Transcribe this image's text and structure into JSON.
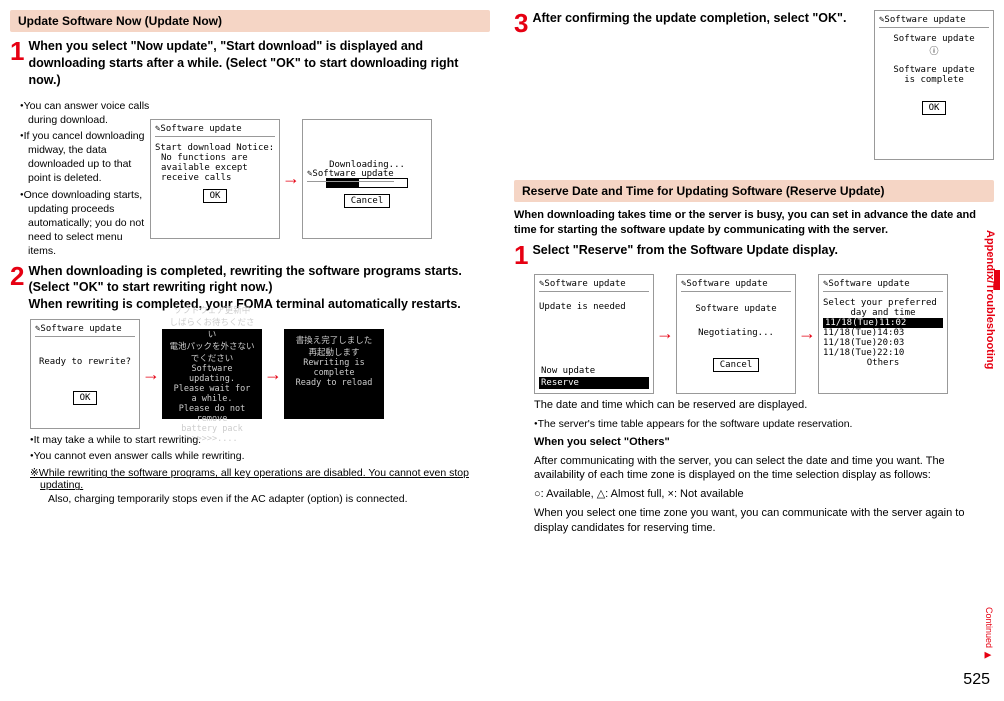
{
  "pageNumber": "525",
  "sideTab": "Appendix/Troubleshooting",
  "continued": "Continued",
  "arrow": "→",
  "left": {
    "hdr1": "Update Software Now (Update Now)",
    "step1": {
      "num": "1",
      "text": "When you select \"Now update\", \"Start download\" is displayed and downloading starts after a while. (Select \"OK\" to start downloading right now.)",
      "b1": "You can answer voice calls during download.",
      "b2": "If you cancel downloading midway, the data downloaded up to that point is deleted.",
      "b3": "Once downloading starts, updating proceeds automatically; you do not need to select menu items."
    },
    "scr_a_title": "Software update",
    "scr_a_l1": "Start download Notice:",
    "scr_a_l2": "No functions are",
    "scr_a_l3": "available except",
    "scr_a_l4": "receive calls",
    "scr_a_btn": "OK",
    "scr_b_title": "Software update",
    "scr_b_body": "Downloading...",
    "scr_b_btn": "Cancel",
    "step2": {
      "num": "2",
      "text": "When downloading is completed, rewriting the software programs starts. (Select \"OK\" to start rewriting right now.)\nWhen rewriting is completed, your FOMA terminal automatically restarts."
    },
    "scr_c_title": "Software update",
    "scr_c_body": "Ready to rewrite?",
    "scr_c_btn": "OK",
    "dark1_l1": "ソフトウェア更新中",
    "dark1_l2": "しばらくお待ちください",
    "dark1_l3": "電池パックを外さない",
    "dark1_l4": "でください",
    "dark1_l5": "Software updating.",
    "dark1_l6": "Please wait for a while.",
    "dark1_l7": "Please do not remove",
    "dark1_l8": "battery pack",
    "dark1_l9": ">>>>>>....",
    "dark2_l1": "書換え完了しました",
    "dark2_l2": "再起動します",
    "dark2_l3": "Rewriting is complete",
    "dark2_l4": "Ready to reload",
    "post_b1": "It may take a while to start rewriting.",
    "post_b2": "You cannot even answer calls while rewriting.",
    "post_star_a": "※While rewriting the software programs, all key operations are disabled. You cannot even stop updating.",
    "post_star_b": "Also, charging temporarily stops even if the AC adapter (option) is connected."
  },
  "right": {
    "step3": {
      "num": "3",
      "text": "After confirming the update completion, select \"OK\"."
    },
    "scr_d_title": "Software update",
    "scr_d_l1": "Software update",
    "scr_d_l2": "ⓘ",
    "scr_d_l3": "Software update",
    "scr_d_l4": "is complete",
    "scr_d_btn": "OK",
    "hdr2": "Reserve Date and Time for Updating Software (Reserve Update)",
    "intro": "When downloading takes time or the server is busy, you can set in advance the date and time for starting the software update by communicating with the server.",
    "step1": {
      "num": "1",
      "text": "Select \"Reserve\" from the Software Update display."
    },
    "scr_e_title": "Software update",
    "scr_e_l1": "Update is needed",
    "scr_e_opt1": "Now update",
    "scr_e_opt2": "Reserve",
    "scr_f_title": "Software update",
    "scr_f_l1": "Software update",
    "scr_f_l2": "Negotiating...",
    "scr_f_btn": "Cancel",
    "scr_g_title": "Software update",
    "scr_g_l1": "Select your preferred",
    "scr_g_l2": "day and time",
    "scr_g_o1": "11/18(Tue)11:02",
    "scr_g_o2": "11/18(Tue)14:03",
    "scr_g_o3": "11/18(Tue)20:03",
    "scr_g_o4": "11/18(Tue)22:10",
    "scr_g_o5": "Others",
    "p1": "The date and time which can be reserved are displayed.",
    "b1": "The server's time table appears for the software update reservation.",
    "sub": "When you select \"Others\"",
    "p2": "After communicating with the server, you can select the date and time you want. The availability of each time zone is displayed on the time selection display as follows:",
    "p3_a": "○: Available, ",
    "p3_b": "△: Almost full, ",
    "p3_c": "×: Not available",
    "p4": "When you select one time zone you want, you can communicate with the server again to display candidates for reserving time."
  }
}
